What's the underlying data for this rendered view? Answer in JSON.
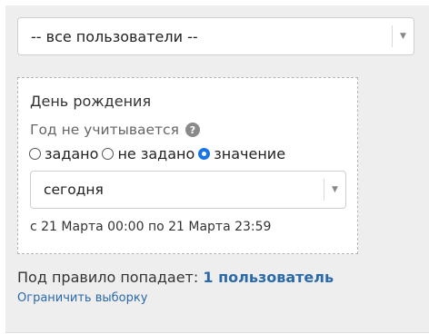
{
  "user_select": {
    "value": "-- все пользователи --"
  },
  "rule": {
    "title": "День рождения",
    "year_hint": "Год не учитывается",
    "radios": [
      {
        "label": "задано",
        "checked": false
      },
      {
        "label": "не задано",
        "checked": false
      },
      {
        "label": "значение",
        "checked": true
      }
    ],
    "date_select": {
      "value": "сегодня"
    },
    "range": "с 21 Марта 00:00 по 21 Марта 23:59"
  },
  "result": {
    "prefix": "Под правило попадает:",
    "count": "1 пользователь"
  },
  "restrict_link": "Ограничить выборку",
  "colors": {
    "panel_bg": "#eeeeee",
    "link": "#2a6aa8",
    "radio_checked": "#1a73e8"
  }
}
